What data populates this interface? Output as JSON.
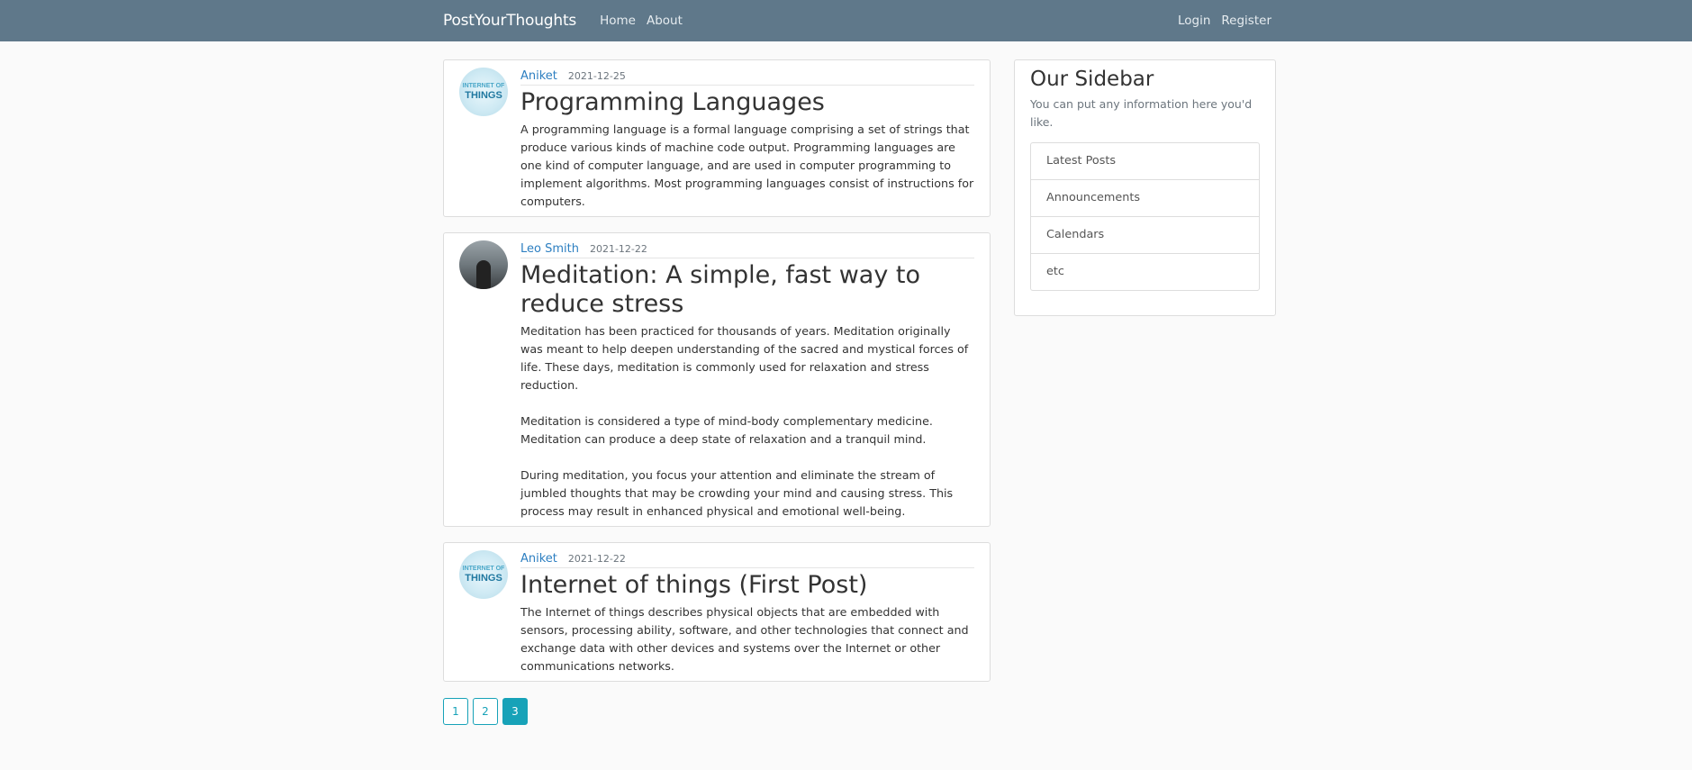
{
  "nav": {
    "brand": "PostYourThoughts",
    "links": [
      "Home",
      "About"
    ],
    "right_links": [
      "Login",
      "Register"
    ]
  },
  "posts": [
    {
      "author": "Aniket",
      "date": "2021-12-25",
      "title": "Programming Languages",
      "avatar_icon": "internet-of-things-avatar",
      "paragraphs": [
        "A programming language is a formal language comprising a set of strings that produce various kinds of machine code output. Programming languages are one kind of computer language, and are used in computer programming to implement algorithms. Most programming languages consist of instructions for computers."
      ]
    },
    {
      "author": "Leo Smith",
      "date": "2021-12-22",
      "title": "Meditation: A simple, fast way to reduce stress",
      "avatar_icon": "person-silhouette-avatar",
      "paragraphs": [
        "Meditation has been practiced for thousands of years. Meditation originally was meant to help deepen understanding of the sacred and mystical forces of life. These days, meditation is commonly used for relaxation and stress reduction.",
        "Meditation is considered a type of mind-body complementary medicine. Meditation can produce a deep state of relaxation and a tranquil mind.",
        "During meditation, you focus your attention and eliminate the stream of jumbled thoughts that may be crowding your mind and causing stress. This process may result in enhanced physical and emotional well-being."
      ]
    },
    {
      "author": "Aniket",
      "date": "2021-12-22",
      "title": "Internet of things (First Post)",
      "avatar_icon": "internet-of-things-avatar",
      "paragraphs": [
        "The Internet of things describes physical objects that are embedded with sensors, processing ability, software, and other technologies that connect and exchange data with other devices and systems over the Internet or other communications networks."
      ]
    }
  ],
  "sidebar": {
    "title": "Our Sidebar",
    "description": "You can put any information here you'd like.",
    "items": [
      "Latest Posts",
      "Announcements",
      "Calendars",
      "etc"
    ]
  },
  "pagination": {
    "pages": [
      "1",
      "2",
      "3"
    ],
    "current": "3"
  },
  "avatar_text": {
    "line1": "INTERNET OF",
    "line2": "THINGS"
  },
  "colors": {
    "navbar": "#5f788a",
    "link": "#2d7fc1",
    "accent": "#17a2b8"
  }
}
